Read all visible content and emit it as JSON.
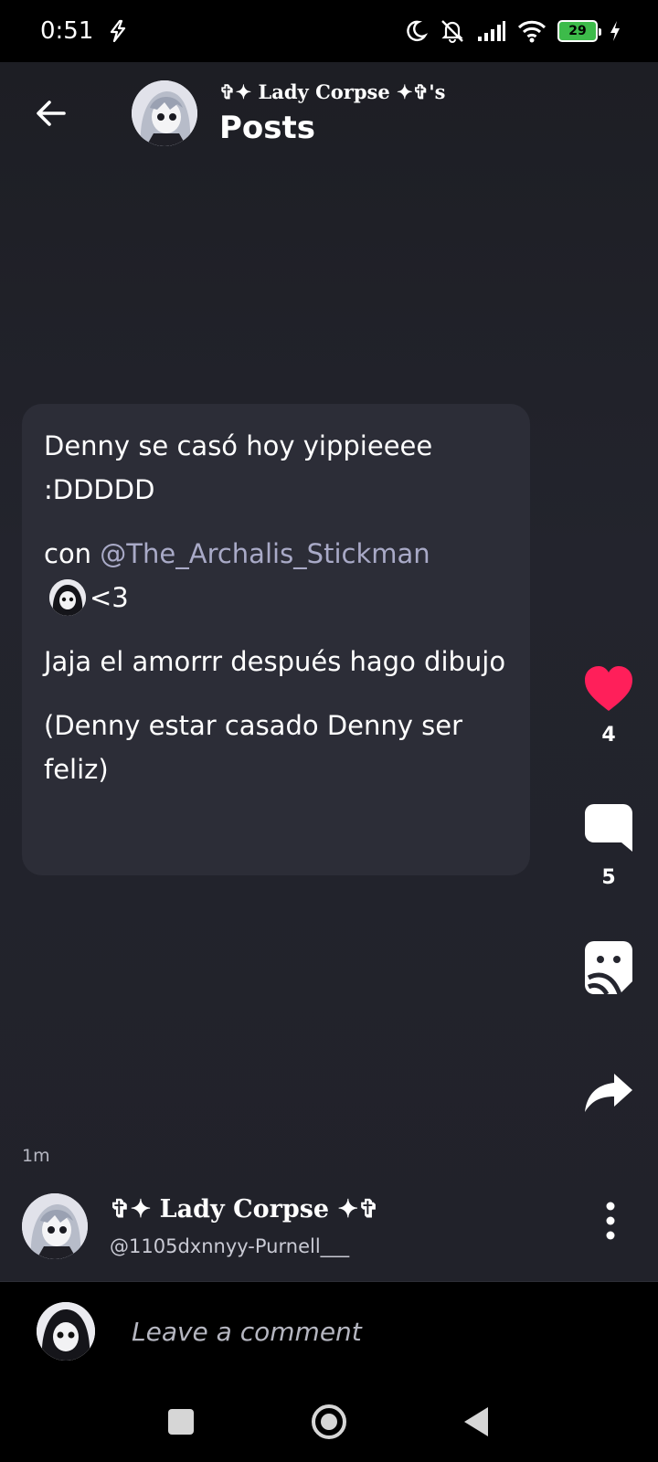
{
  "status_bar": {
    "time": "0:51",
    "battery": "29"
  },
  "header": {
    "subtitle": "✞✦ Lady Corpse ✦✞'s",
    "title": "Posts"
  },
  "post": {
    "paragraph1": "Denny se casó hoy yippieeee :DDDDD",
    "paragraph2_prefix": "con ",
    "mention": "@The_Archalis_Stickman",
    "paragraph2_suffix": "<3",
    "paragraph3": "Jaja el amorrr después hago dibujo",
    "paragraph4": "(Denny estar casado Denny ser feliz)",
    "timestamp": "1m"
  },
  "actions": {
    "likes": "4",
    "comments": "5"
  },
  "author": {
    "name": "✞✦ Lady Corpse ✦✞",
    "handle": "@1105dxnnyy-Purnell___"
  },
  "comment_bar": {
    "placeholder": "Leave a comment"
  },
  "colors": {
    "like": "#ff1f5a",
    "card": "#2c2d37",
    "mention": "#a9aac7"
  }
}
